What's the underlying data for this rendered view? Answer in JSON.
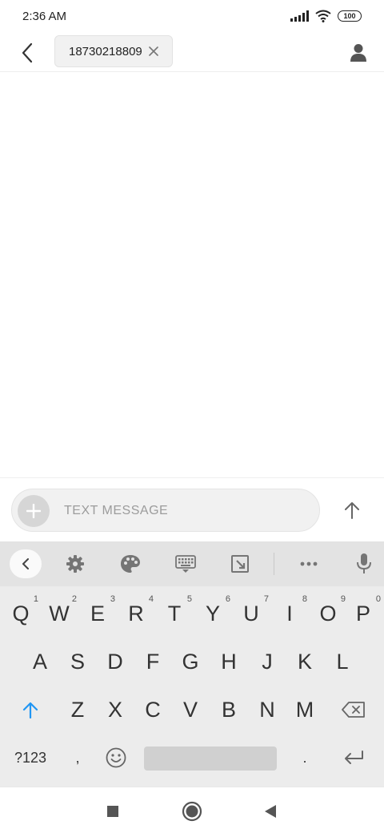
{
  "status_bar": {
    "time": "2:36 AM",
    "battery": "100"
  },
  "header": {
    "recipient": "18730218809"
  },
  "compose": {
    "placeholder": "TEXT MESSAGE"
  },
  "keyboard": {
    "row1": [
      {
        "label": "Q",
        "hint": "1"
      },
      {
        "label": "W",
        "hint": "2"
      },
      {
        "label": "E",
        "hint": "3"
      },
      {
        "label": "R",
        "hint": "4"
      },
      {
        "label": "T",
        "hint": "5"
      },
      {
        "label": "Y",
        "hint": "6"
      },
      {
        "label": "U",
        "hint": "7"
      },
      {
        "label": "I",
        "hint": "8"
      },
      {
        "label": "O",
        "hint": "9"
      },
      {
        "label": "P",
        "hint": "0"
      }
    ],
    "row2": [
      "A",
      "S",
      "D",
      "F",
      "G",
      "H",
      "J",
      "K",
      "L"
    ],
    "row3": [
      "Z",
      "X",
      "C",
      "V",
      "B",
      "N",
      "M"
    ],
    "symbols_label": "?123",
    "comma_label": ",",
    "period_label": ".",
    "accent_color": "#2196f3"
  },
  "icons": {
    "toolbar": [
      "chevron-left-icon",
      "gear-icon",
      "palette-icon",
      "keyboard-icon",
      "resize-icon",
      "more-icon",
      "mic-icon"
    ],
    "nav": [
      "square-icon",
      "home-circle-icon",
      "back-triangle-icon"
    ]
  }
}
